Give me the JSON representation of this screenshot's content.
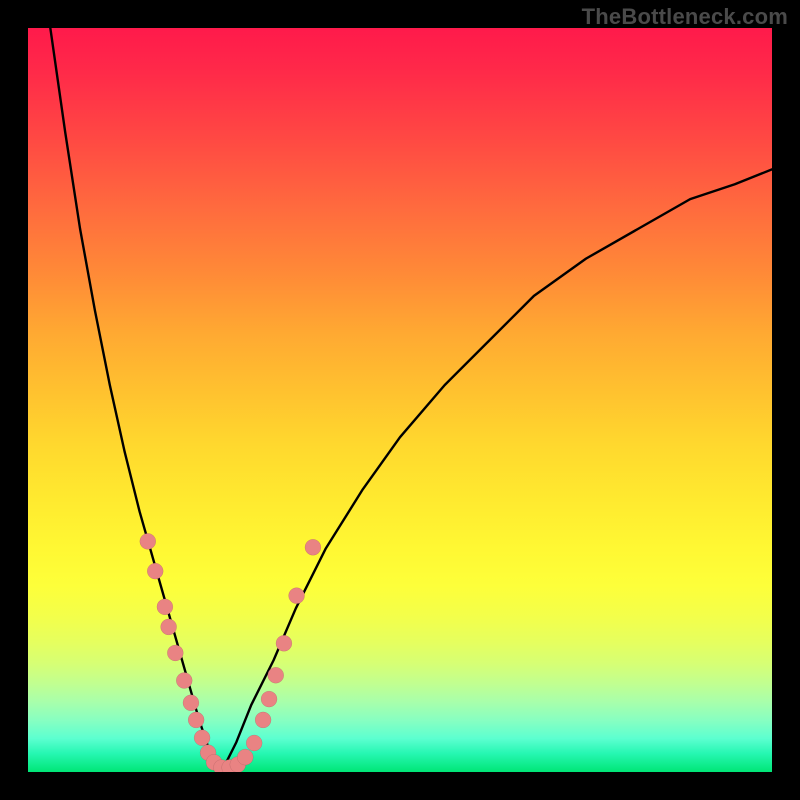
{
  "watermark": "TheBottleneck.com",
  "colors": {
    "frame_bg": "#000000",
    "curve_stroke": "#000000",
    "marker_fill": "#e98383",
    "gradient_stops": [
      "#ff1a4b",
      "#ff2a49",
      "#ff4943",
      "#ff6a3e",
      "#ff8a37",
      "#ffa932",
      "#ffc22f",
      "#ffd82e",
      "#ffe92f",
      "#fff833",
      "#fdff3a",
      "#f3ff4a",
      "#e6ff5e",
      "#d6ff75",
      "#c2ff8f",
      "#a9ffaa",
      "#88ffc1",
      "#5cffd0",
      "#26f7b2",
      "#00e676"
    ]
  },
  "chart_data": {
    "type": "line",
    "title": "",
    "xlabel": "",
    "ylabel": "",
    "xlim": [
      0,
      100
    ],
    "ylim": [
      0,
      100
    ],
    "legend": false,
    "grid": false,
    "notes": "Two smooth black curves descending to a shared minimum near x≈26, tracing a V. Salmon dots lie along the curve near the minimum region. Background is a vertical red→yellow→green gradient. No axis ticks or labels are shown; values below are estimated from pixel position.",
    "series": [
      {
        "name": "left-curve",
        "x": [
          3,
          5,
          7,
          9,
          11,
          13,
          15,
          17,
          19,
          21,
          23,
          24,
          25,
          26
        ],
        "y": [
          100,
          86,
          73,
          62,
          52,
          43,
          35,
          28,
          21,
          14,
          7,
          4,
          1,
          0
        ]
      },
      {
        "name": "right-curve",
        "x": [
          26,
          28,
          30,
          33,
          36,
          40,
          45,
          50,
          56,
          62,
          68,
          75,
          82,
          89,
          95,
          100
        ],
        "y": [
          0,
          4,
          9,
          15,
          22,
          30,
          38,
          45,
          52,
          58,
          64,
          69,
          73,
          77,
          79,
          81
        ]
      }
    ],
    "markers": {
      "name": "salmon-dots",
      "points": [
        {
          "x": 16.1,
          "y": 31.0
        },
        {
          "x": 17.1,
          "y": 27.0
        },
        {
          "x": 18.4,
          "y": 22.2
        },
        {
          "x": 18.9,
          "y": 19.5
        },
        {
          "x": 19.8,
          "y": 16.0
        },
        {
          "x": 21.0,
          "y": 12.3
        },
        {
          "x": 21.9,
          "y": 9.3
        },
        {
          "x": 22.6,
          "y": 7.0
        },
        {
          "x": 23.4,
          "y": 4.6
        },
        {
          "x": 24.2,
          "y": 2.6
        },
        {
          "x": 25.0,
          "y": 1.3
        },
        {
          "x": 26.0,
          "y": 0.6
        },
        {
          "x": 27.1,
          "y": 0.6
        },
        {
          "x": 28.2,
          "y": 1.0
        },
        {
          "x": 29.2,
          "y": 2.0
        },
        {
          "x": 30.4,
          "y": 3.9
        },
        {
          "x": 31.6,
          "y": 7.0
        },
        {
          "x": 32.4,
          "y": 9.8
        },
        {
          "x": 33.3,
          "y": 13.0
        },
        {
          "x": 34.4,
          "y": 17.3
        },
        {
          "x": 36.1,
          "y": 23.7
        },
        {
          "x": 38.3,
          "y": 30.2
        }
      ],
      "radius_px": 8
    }
  }
}
